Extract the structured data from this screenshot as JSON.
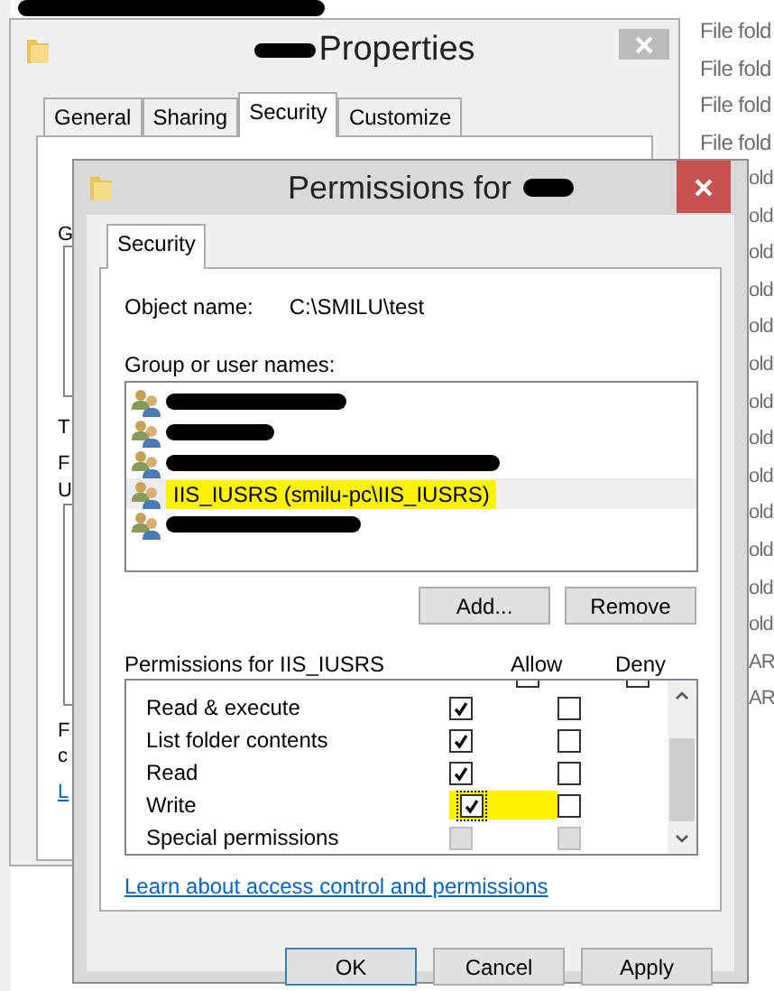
{
  "explorer": {
    "type_column": [
      "File fold",
      "File fold",
      "File fold",
      "File fold"
    ],
    "type_column_cut": [
      "old",
      "old",
      "old",
      "old",
      "old",
      "old",
      "old",
      "old",
      "old",
      "old",
      "old",
      "old",
      "old",
      "AR",
      "AR"
    ]
  },
  "properties_window": {
    "title": "Properties",
    "tabs": [
      {
        "label": "General",
        "selected": false
      },
      {
        "label": "Sharing",
        "selected": false
      },
      {
        "label": "Security",
        "selected": true
      },
      {
        "label": "Customize",
        "selected": false
      }
    ],
    "cut_texts": [
      "G",
      "T",
      "F",
      "U",
      "F",
      "c"
    ],
    "cut_link": "L"
  },
  "permissions_window": {
    "title": "Permissions for",
    "tabs": [
      {
        "label": "Security",
        "selected": true
      }
    ],
    "object_name_label": "Object name:",
    "object_name_value": "C:\\SMILU\\test",
    "group_label": "Group or user names:",
    "users": [
      {
        "kind": "redacted",
        "selected": false,
        "highlighted": false
      },
      {
        "kind": "redacted",
        "selected": false,
        "highlighted": false
      },
      {
        "kind": "redacted",
        "selected": false,
        "highlighted": false
      },
      {
        "kind": "named",
        "name": "IIS_IUSRS (smilu-pc\\IIS_IUSRS)",
        "selected": true,
        "highlighted": true
      },
      {
        "kind": "redacted",
        "selected": false,
        "highlighted": false
      }
    ],
    "buttons_top": [
      "Add...",
      "Remove"
    ],
    "permissions_label": "Permissions for IIS_IUSRS",
    "allow_header": "Allow",
    "deny_header": "Deny",
    "permissions": [
      {
        "name": "Read & execute",
        "allow": true,
        "deny": false,
        "disabled": false,
        "highlighted": false
      },
      {
        "name": "List folder contents",
        "allow": true,
        "deny": false,
        "disabled": false,
        "highlighted": false
      },
      {
        "name": "Read",
        "allow": true,
        "deny": false,
        "disabled": false,
        "highlighted": false
      },
      {
        "name": "Write",
        "allow": true,
        "deny": false,
        "disabled": false,
        "highlighted": true
      },
      {
        "name": "Special permissions",
        "allow": false,
        "deny": false,
        "disabled": true,
        "highlighted": false
      }
    ],
    "link": "Learn about access control and permissions",
    "buttons": [
      {
        "label": "OK",
        "default": true
      },
      {
        "label": "Cancel",
        "default": false
      },
      {
        "label": "Apply",
        "default": false
      }
    ]
  }
}
